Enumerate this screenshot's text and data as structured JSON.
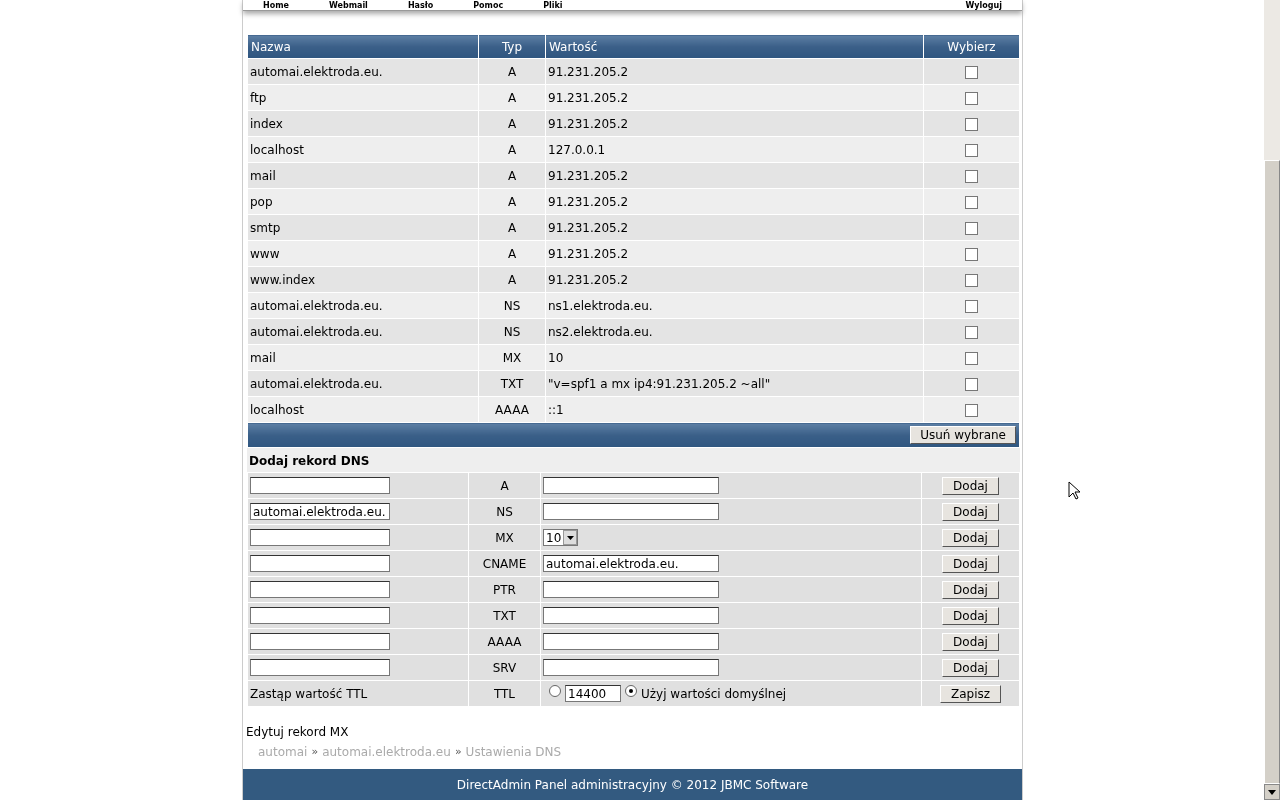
{
  "nav": [
    {
      "label": "Home"
    },
    {
      "label": "Webmail"
    },
    {
      "label": "Hasło"
    },
    {
      "label": "Pomoc"
    },
    {
      "label": "Pliki"
    },
    {
      "label": "Wyloguj"
    }
  ],
  "records": {
    "columns": [
      "Nazwa",
      "Typ",
      "Wartość",
      "Wybierz"
    ],
    "rows": [
      {
        "name": "automai.elektroda.eu.",
        "type": "A",
        "value": "91.231.205.2",
        "checked": false
      },
      {
        "name": "ftp",
        "type": "A",
        "value": "91.231.205.2",
        "checked": false
      },
      {
        "name": "index",
        "type": "A",
        "value": "91.231.205.2",
        "checked": false
      },
      {
        "name": "localhost",
        "type": "A",
        "value": "127.0.0.1",
        "checked": false
      },
      {
        "name": "mail",
        "type": "A",
        "value": "91.231.205.2",
        "checked": false
      },
      {
        "name": "pop",
        "type": "A",
        "value": "91.231.205.2",
        "checked": false
      },
      {
        "name": "smtp",
        "type": "A",
        "value": "91.231.205.2",
        "checked": false
      },
      {
        "name": "www",
        "type": "A",
        "value": "91.231.205.2",
        "checked": false
      },
      {
        "name": "www.index",
        "type": "A",
        "value": "91.231.205.2",
        "checked": false
      },
      {
        "name": "automai.elektroda.eu.",
        "type": "NS",
        "value": "ns1.elektroda.eu.",
        "checked": false
      },
      {
        "name": "automai.elektroda.eu.",
        "type": "NS",
        "value": "ns2.elektroda.eu.",
        "checked": false
      },
      {
        "name": "mail",
        "type": "MX",
        "value": "10",
        "checked": false
      },
      {
        "name": "automai.elektroda.eu.",
        "type": "TXT",
        "value": "\"v=spf1 a mx ip4:91.231.205.2 ~all\"",
        "checked": false
      },
      {
        "name": "localhost",
        "type": "AAAA",
        "value": "::1",
        "checked": false
      }
    ],
    "delete_button": "Usuń wybrane"
  },
  "add_form": {
    "title": "Dodaj rekord DNS",
    "rows": [
      {
        "kind": "text",
        "type": "A",
        "button": "Dodaj"
      },
      {
        "kind": "text",
        "name_value": "automai.elektroda.eu.",
        "type": "NS",
        "button": "Dodaj"
      },
      {
        "kind": "select",
        "type": "MX",
        "select_value": "10",
        "button": "Dodaj"
      },
      {
        "kind": "text",
        "type": "CNAME",
        "value": "automai.elektroda.eu.",
        "button": "Dodaj"
      },
      {
        "kind": "text",
        "type": "PTR",
        "button": "Dodaj"
      },
      {
        "kind": "text",
        "type": "TXT",
        "button": "Dodaj"
      },
      {
        "kind": "text",
        "type": "AAAA",
        "button": "Dodaj"
      },
      {
        "kind": "text",
        "type": "SRV",
        "button": "Dodaj"
      },
      {
        "kind": "ttl",
        "label": "Zastąp wartość TTL",
        "type": "TTL",
        "ttl_value": "14400",
        "custom_selected": false,
        "default_label": "Użyj wartości domyślnej",
        "default_selected": true,
        "button": "Zapisz"
      }
    ]
  },
  "edit_link": "Edytuj rekord MX",
  "breadcrumb": [
    {
      "label": "automai",
      "separator": "»"
    },
    {
      "label": "automai.elektroda.eu",
      "separator": "»"
    },
    {
      "label": "Ustawienia DNS"
    }
  ],
  "footer": "DirectAdmin Panel administracyjny © 2012 JBMC Software"
}
